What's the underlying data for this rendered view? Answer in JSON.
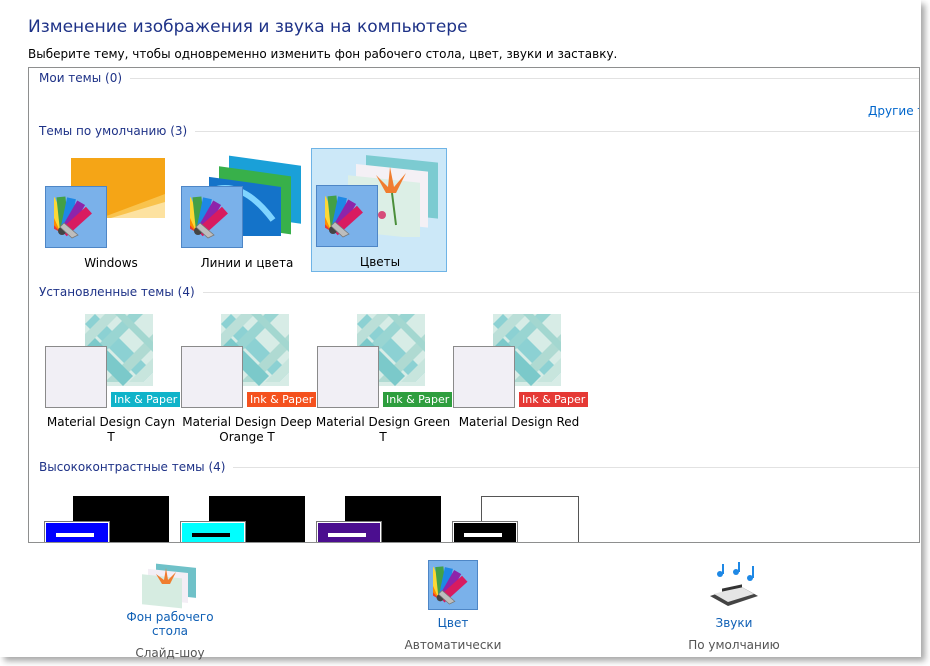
{
  "header": {
    "title": "Изменение изображения и звука на компьютере",
    "subtitle": "Выберите тему, чтобы одновременно изменить фон рабочего стола, цвет, звуки и заставку."
  },
  "groups": {
    "my": {
      "label": "Мои темы (0)",
      "link": "Другие те"
    },
    "default": {
      "label": "Темы по умолчанию (3)",
      "items": [
        {
          "name": "Windows"
        },
        {
          "name": "Линии и цвета"
        },
        {
          "name": "Цветы",
          "selected": true
        }
      ]
    },
    "installed": {
      "label": "Установленные темы (4)",
      "badge_text": "Ink & Paper",
      "items": [
        {
          "name": "Material Design Cayn T",
          "badge_color": "#10b3c9"
        },
        {
          "name": "Material Design Deep Orange T",
          "badge_color": "#f4511e"
        },
        {
          "name": "Material Design Green T",
          "badge_color": "#2e9e3e"
        },
        {
          "name": "Material Design Red",
          "badge_color": "#e53935"
        }
      ]
    },
    "highcontrast": {
      "label": "Высококонтрастные темы (4)",
      "items": [
        {
          "swatch": "#0000ff"
        },
        {
          "swatch": "#00ffff"
        },
        {
          "swatch": "#4b0e8f"
        },
        {
          "swatch": "#000000"
        }
      ]
    }
  },
  "bottom": {
    "background": {
      "label": "Фон рабочего стола",
      "sub": "Слайд-шоу"
    },
    "color": {
      "label": "Цвет",
      "sub": "Автоматически"
    },
    "sounds": {
      "label": "Звуки",
      "sub": "По умолчанию"
    }
  },
  "colors": {
    "title": "#1e3287",
    "link": "#0066cc",
    "selection": "#cce8f8"
  }
}
